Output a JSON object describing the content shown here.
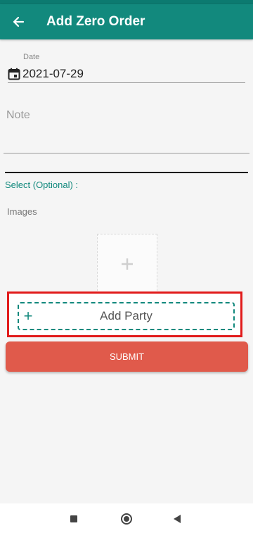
{
  "app_bar": {
    "title": "Add Zero Order",
    "back_icon": "arrow-left-icon",
    "color": "#12897d"
  },
  "form": {
    "date": {
      "label": "Date",
      "value": "2021-07-29",
      "icon": "calendar-icon"
    },
    "note": {
      "placeholder": "Note"
    },
    "select_label": "Select (Optional) :",
    "images": {
      "label": "Images",
      "add_icon": "plus-icon"
    },
    "add_party": {
      "icon": "+",
      "label": "Add Party",
      "highlight_color": "#e11b1b"
    },
    "submit": {
      "label": "SUBMIT",
      "color": "#e05a4b"
    }
  },
  "nav_bar": {
    "recents_icon": "square-icon",
    "home_icon": "circle-icon",
    "back_icon": "triangle-back-icon"
  }
}
